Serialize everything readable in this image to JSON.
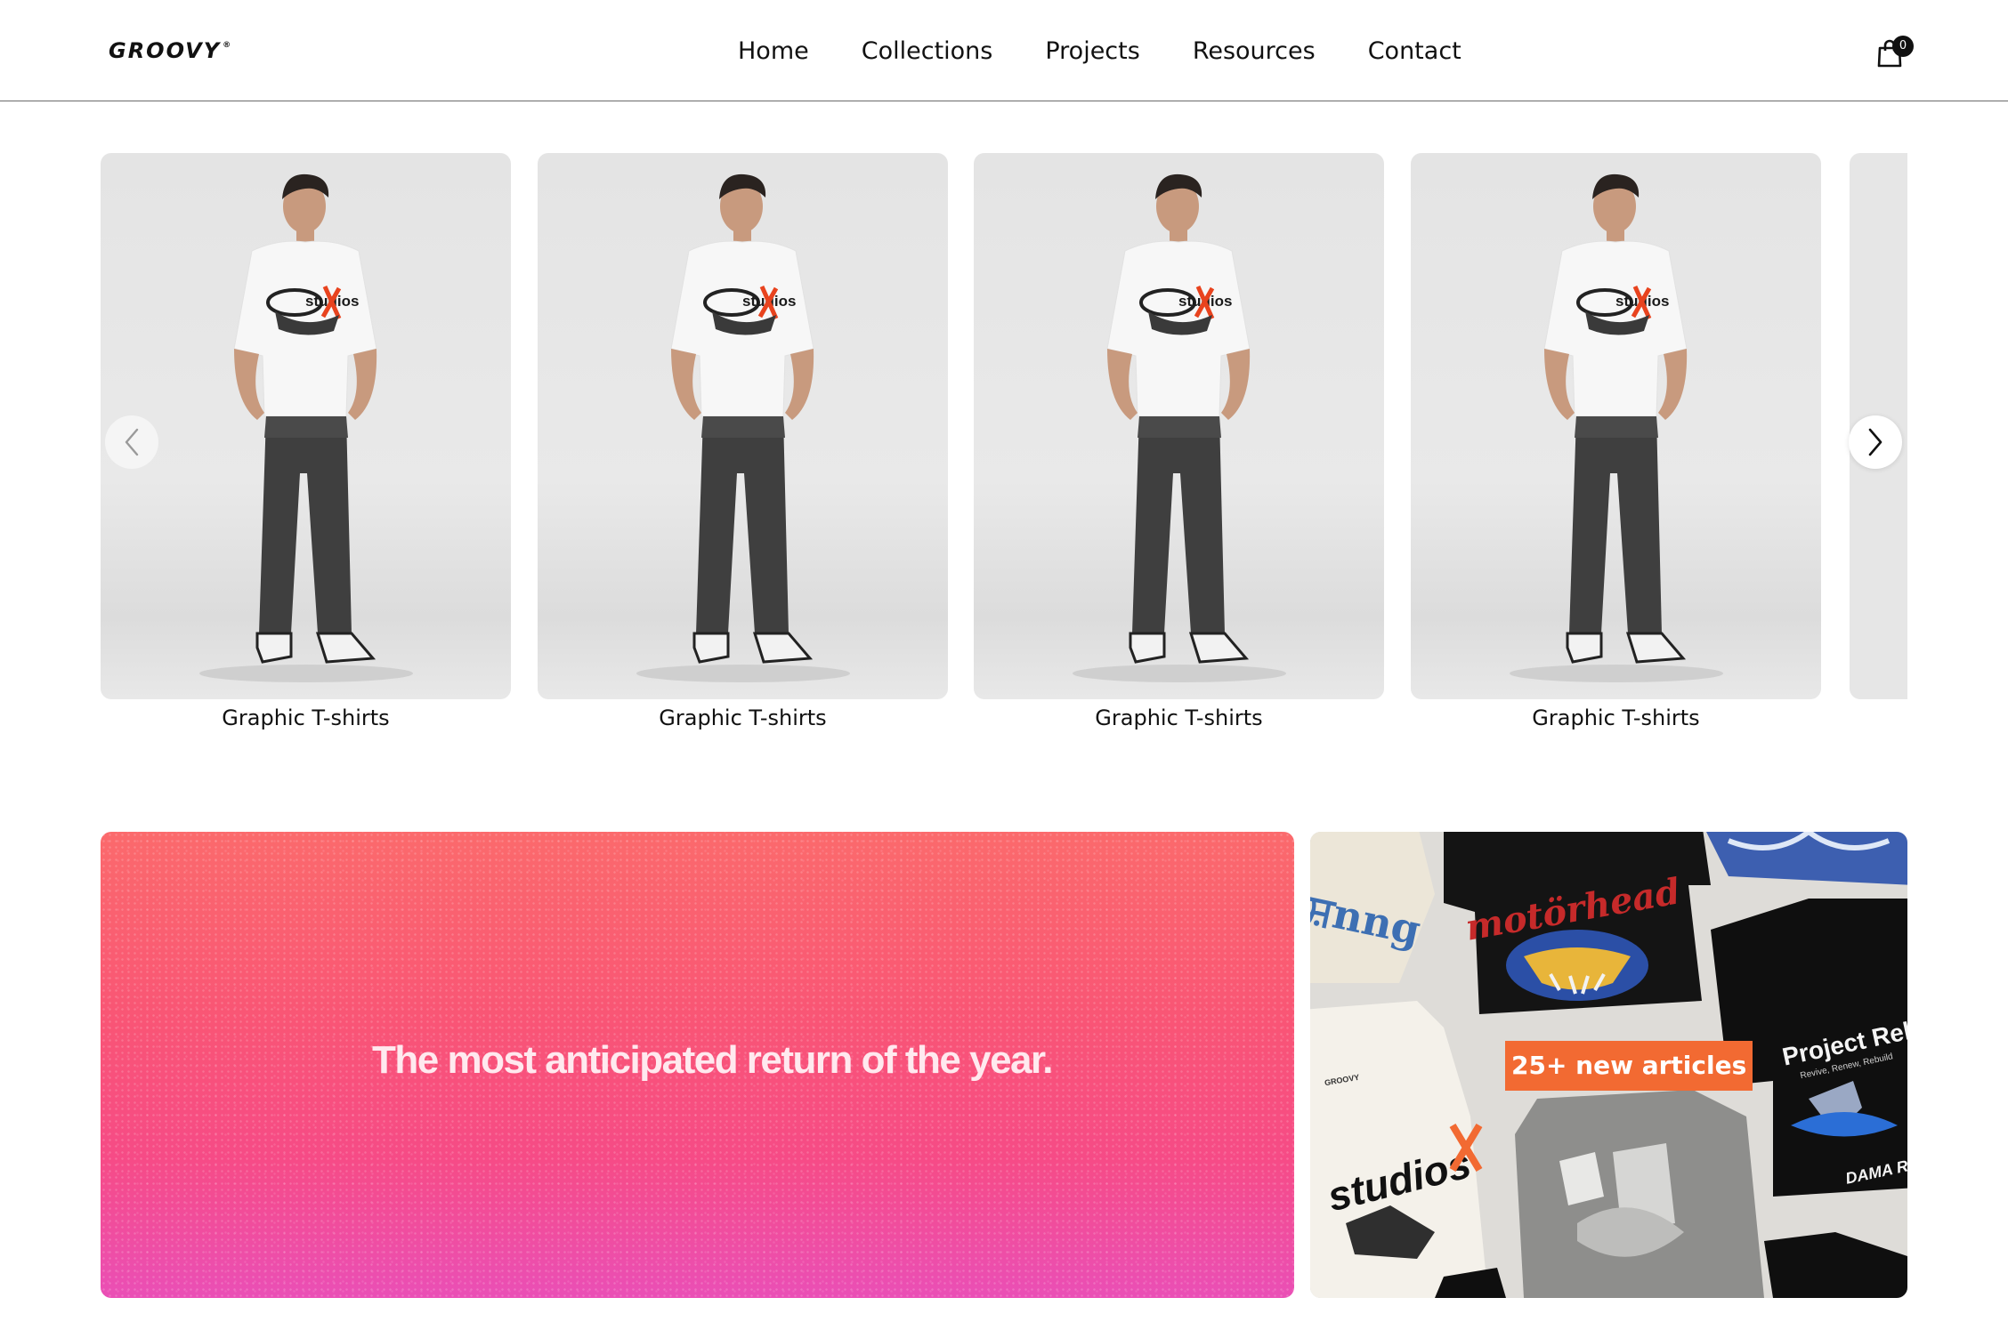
{
  "header": {
    "logo": "GROOVY",
    "logo_mark": "®",
    "nav": [
      "Home",
      "Collections",
      "Projects",
      "Resources",
      "Contact"
    ],
    "cart_count": "0",
    "cart_icon": "shopping-bag-icon"
  },
  "carousel": {
    "prev_icon": "chevron-left-icon",
    "next_icon": "chevron-right-icon",
    "items": [
      {
        "label": "Graphic T-shirts"
      },
      {
        "label": "Graphic T-shirts"
      },
      {
        "label": "Graphic T-shirts"
      },
      {
        "label": "Graphic T-shirts"
      }
    ],
    "shirt_print": "studios"
  },
  "promo": {
    "headline": "The most anticipated return of the year."
  },
  "feature": {
    "badge": "25+ new articles",
    "shirt_prints": [
      "motörhead",
      "Project Rebi",
      "Revive, Renew, Rebuild",
      "studios",
      "GROOVY"
    ]
  },
  "colors": {
    "accent_orange": "#f26a32",
    "promo_gradient_top": "#fb6a6c",
    "promo_gradient_bottom": "#ea4fb6"
  }
}
